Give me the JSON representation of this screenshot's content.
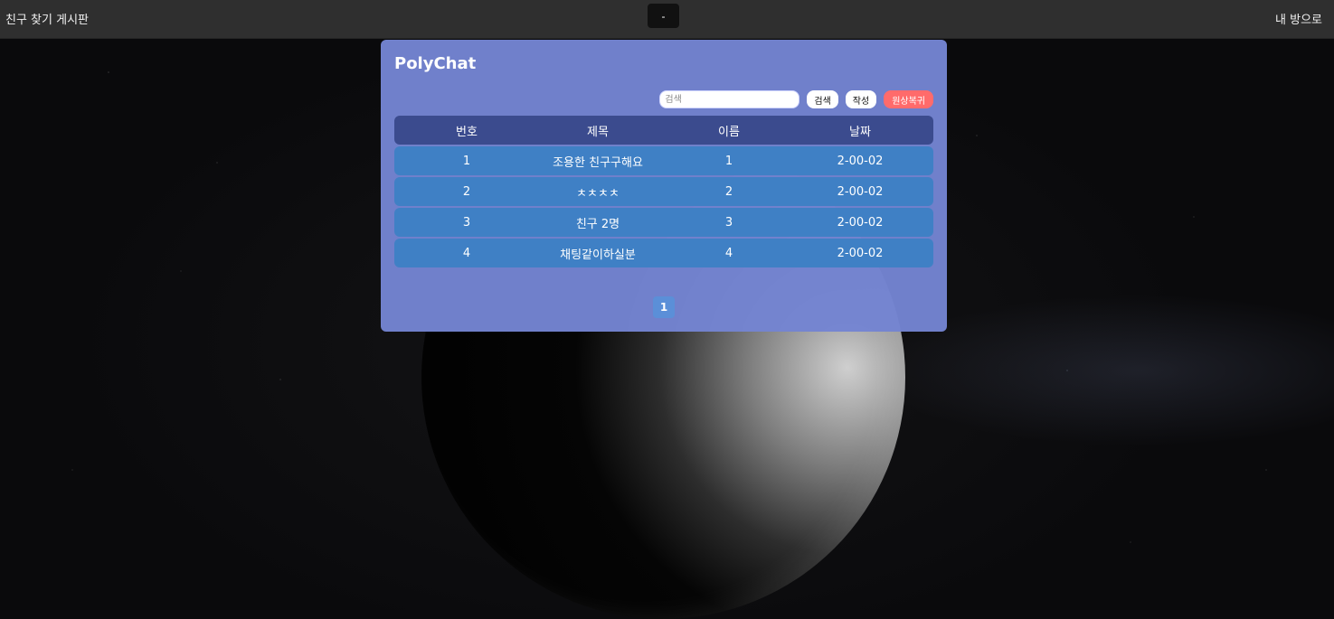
{
  "topbar": {
    "title": "친구 찾기 게시판",
    "center_button": "-",
    "right_link": "내 방으로"
  },
  "panel": {
    "brand": "PolyChat",
    "search": {
      "placeholder": "검색",
      "value": ""
    },
    "buttons": {
      "search": "검색",
      "write": "작성",
      "reset": "원상복귀"
    },
    "table": {
      "headers": [
        "번호",
        "제목",
        "이름",
        "날짜"
      ],
      "rows": [
        {
          "no": "1",
          "title": "조용한 친구구해요",
          "name": "1",
          "date": "2-00-02"
        },
        {
          "no": "2",
          "title": "ㅊㅊㅊㅊ",
          "name": "2",
          "date": "2-00-02"
        },
        {
          "no": "3",
          "title": "친구 2명",
          "name": "3",
          "date": "2-00-02"
        },
        {
          "no": "4",
          "title": "채팅같이하실분",
          "name": "4",
          "date": "2-00-02"
        }
      ]
    },
    "pagination": {
      "current": "1"
    }
  },
  "colors": {
    "panel_bg": "#7484d2",
    "header_row": "#3b4b8e",
    "data_row": "#3f80c5",
    "reset_button": "#ff6b6b",
    "topbar": "#2f2f2f"
  },
  "background": {
    "scene": "space-moon"
  }
}
